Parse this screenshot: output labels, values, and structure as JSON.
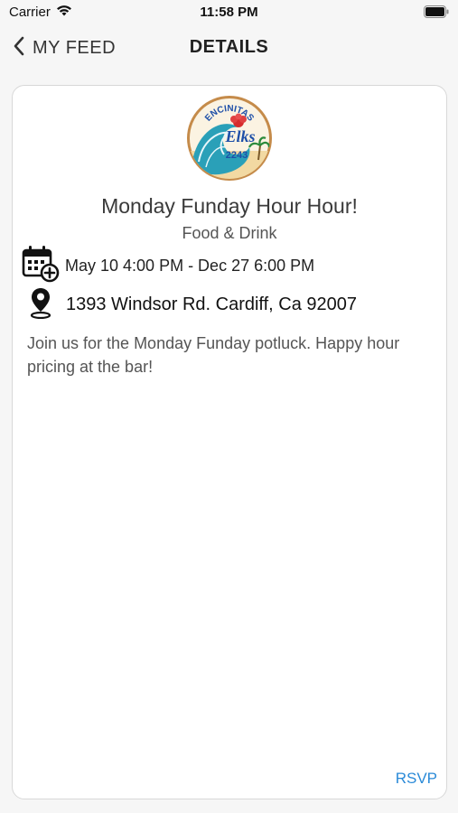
{
  "status_bar": {
    "carrier": "Carrier",
    "time": "11:58 PM"
  },
  "nav": {
    "back_label": "MY FEED",
    "title": "DETAILS"
  },
  "event": {
    "logo": {
      "top_text": "ENCINITAS",
      "script_text": "Elks",
      "number": "2243"
    },
    "title": "Monday Funday Hour Hour!",
    "category": "Food & Drink",
    "date_range": "May 10 4:00 PM - Dec 27 6:00 PM",
    "location": "1393 Windsor Rd. Cardiff, Ca 92007",
    "description": "Join us for the Monday Funday potluck.  Happy hour pricing at the bar!",
    "rsvp_label": "RSVP"
  },
  "colors": {
    "accent": "#2a8ad8",
    "text": "#222222",
    "muted": "#555555"
  },
  "icons": [
    "wifi-icon",
    "battery-icon",
    "chevron-left-icon",
    "calendar-add-icon",
    "location-pin-icon"
  ]
}
